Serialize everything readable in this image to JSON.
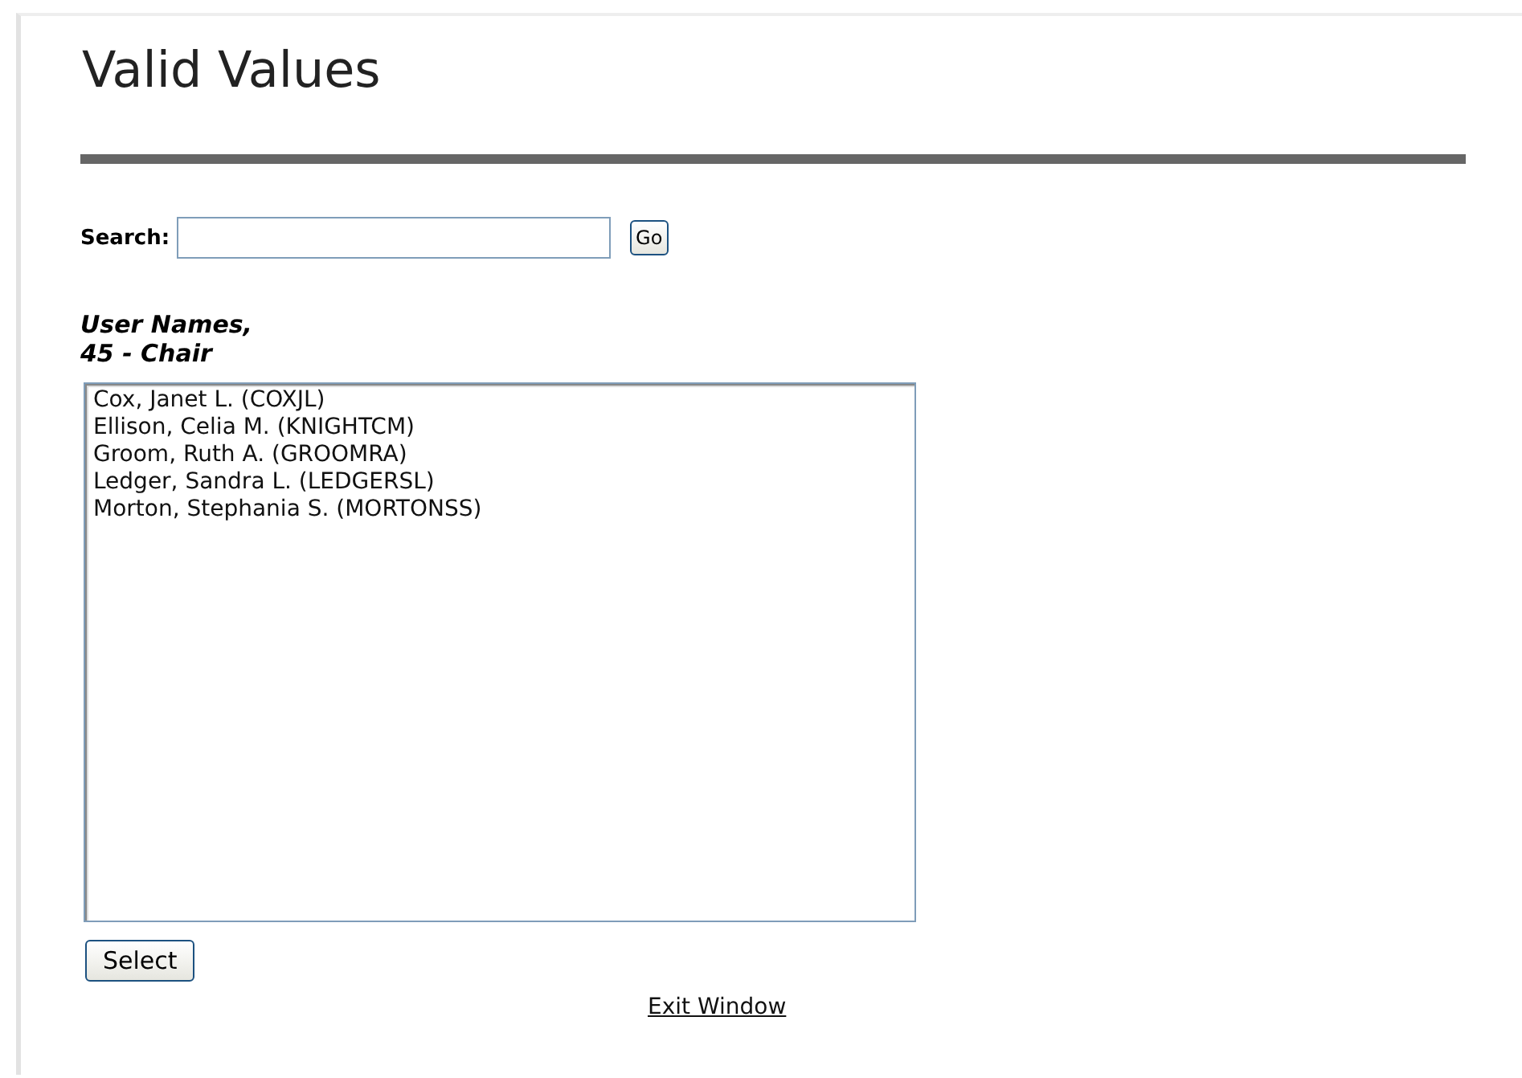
{
  "title": "Valid Values",
  "search": {
    "label": "Search:",
    "button": "Go"
  },
  "list_heading": [
    "User Names,",
    "45 - Chair"
  ],
  "list_items": [
    {
      "text": "Cox, Janet L. (COXJL)",
      "selected": false
    },
    {
      "text": "Ellison, Celia M. (KNIGHTCM)",
      "selected": false
    },
    {
      "text": "Groom, Ruth A. (GROOMRA)",
      "selected": false
    },
    {
      "text": "Ledger, Sandra L. (LEDGERSL)",
      "selected": false
    },
    {
      "text": "Morton, Stephania S. (MORTONSS)",
      "selected": false
    }
  ],
  "select_button": "Select",
  "exit_link": "Exit Window"
}
